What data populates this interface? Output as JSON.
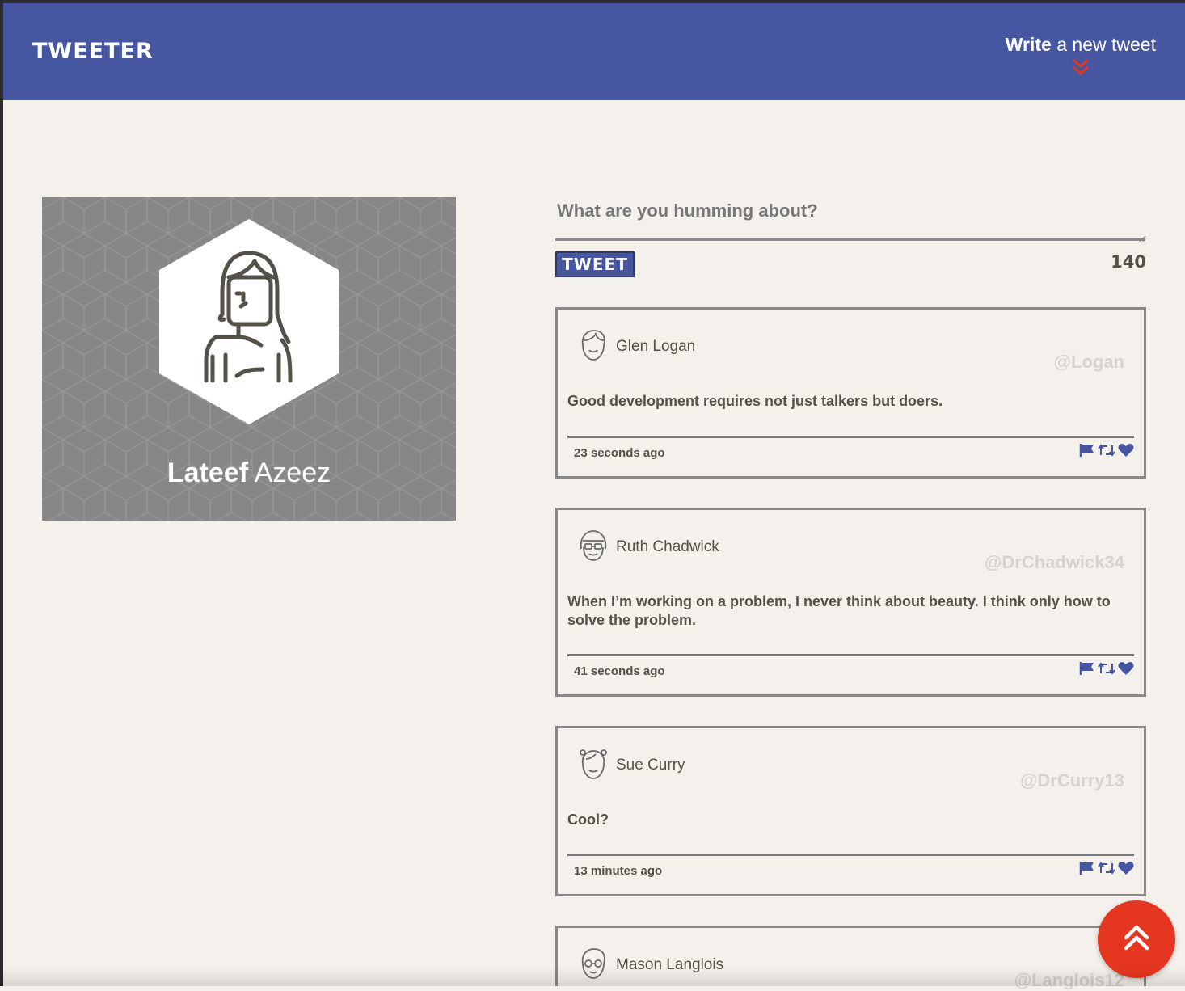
{
  "nav": {
    "brand": "TWEETER",
    "write_bold": "Write",
    "write_rest": " a new tweet"
  },
  "profile": {
    "first_name": "Lateef",
    "last_name": " Azeez"
  },
  "composer": {
    "placeholder": "What are you humming about?",
    "button_label": "TWEET",
    "counter": "140"
  },
  "tweets": [
    {
      "name": "Glen Logan",
      "handle": "@Logan",
      "text": "Good development requires not just talkers but doers.",
      "time": "23 seconds ago"
    },
    {
      "name": "Ruth Chadwick",
      "handle": "@DrChadwick34",
      "text": "When I’m working on a problem, I never think about beauty. I think only how to solve the problem.",
      "time": "41 seconds ago"
    },
    {
      "name": "Sue Curry",
      "handle": "@DrCurry13",
      "text": "Cool?",
      "time": "13 minutes ago"
    },
    {
      "name": "Mason Langlois",
      "handle": "@Langlois12",
      "text": "",
      "time": ""
    }
  ],
  "icons": {
    "flag": "flag-icon",
    "retweet": "retweet-icon",
    "like": "heart-icon",
    "scroll_top": "double-chevron-up-icon",
    "write_chevron": "double-chevron-down-icon"
  },
  "colors": {
    "nav_bg": "#4656a0",
    "page_bg": "#f4f1ec",
    "accent": "#e5371f",
    "profile_bg": "#878787",
    "text": "#545149",
    "handle": "#d6d3ce"
  }
}
